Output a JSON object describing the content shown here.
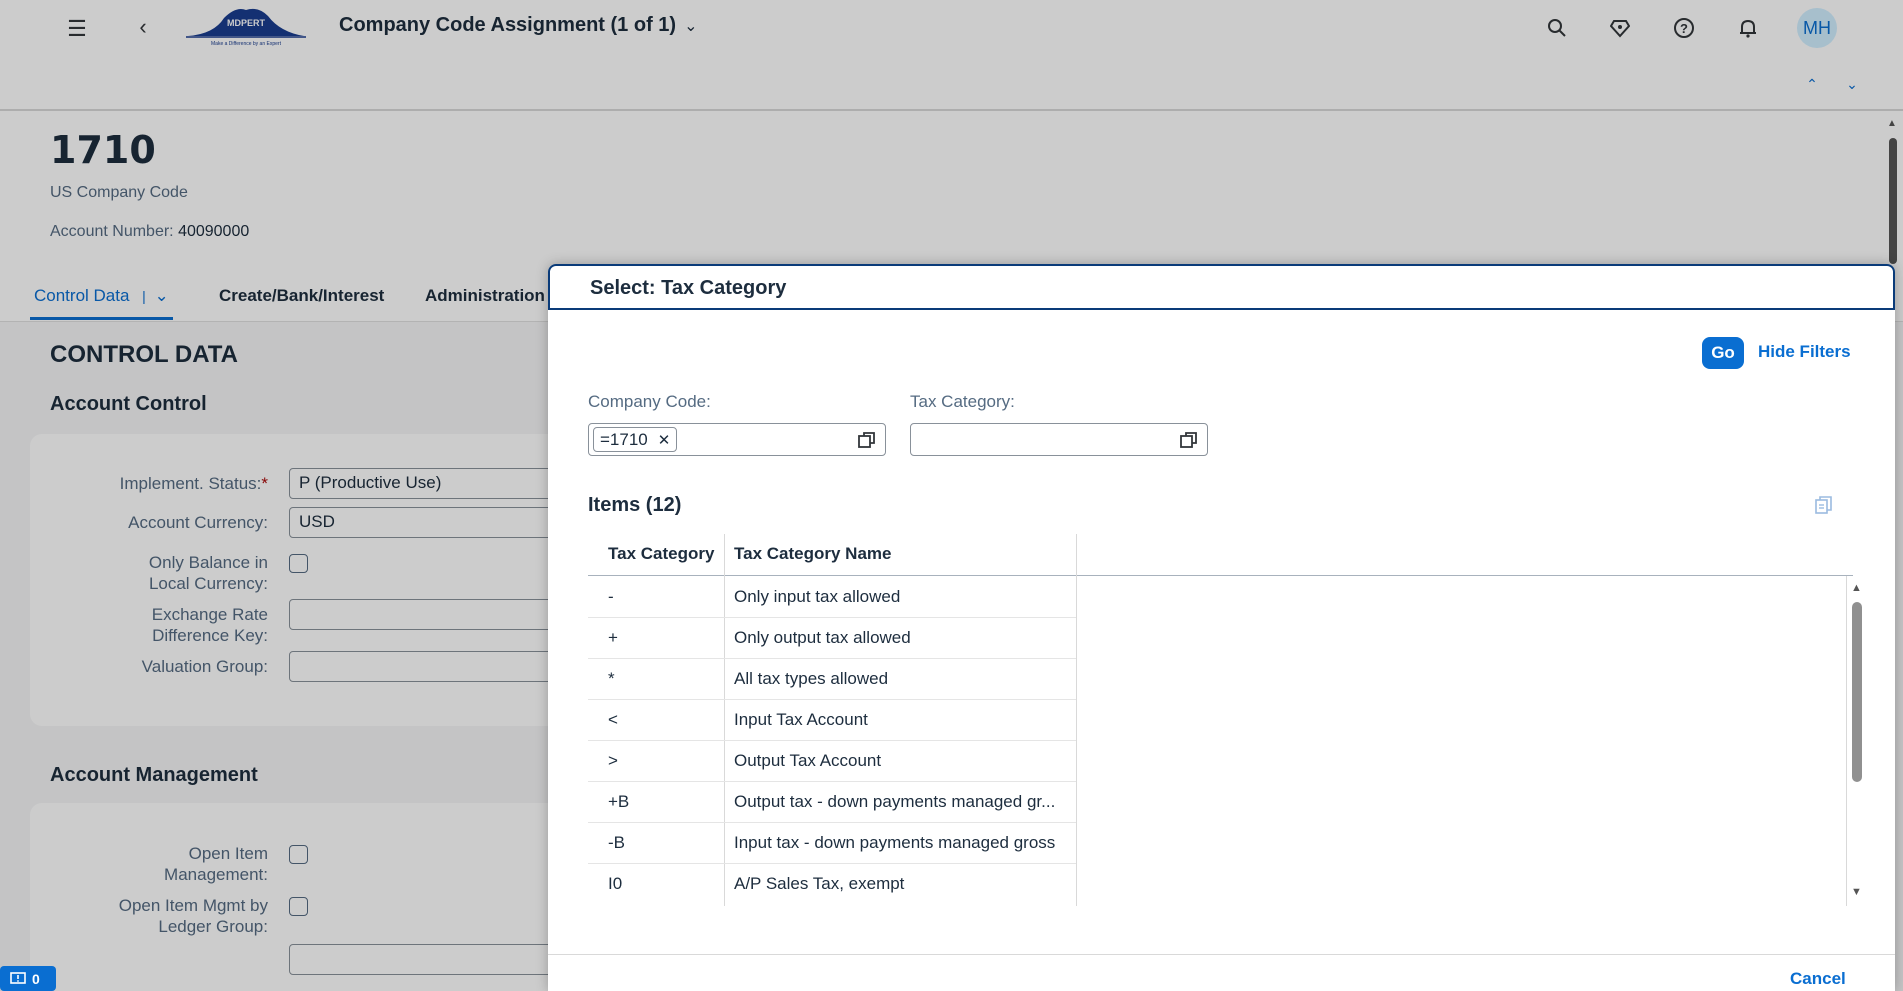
{
  "shell": {
    "app_title": "Company Code Assignment (1 of 1)",
    "logo_text": "MDPERT",
    "logo_tagline": "Make a Difference by an Expert",
    "avatar_initials": "MH",
    "icons": [
      "menu-icon",
      "back-icon",
      "search-icon",
      "diamond-icon",
      "help-icon",
      "bell-icon"
    ]
  },
  "object": {
    "title": "1710",
    "subtitle": "US Company Code",
    "account_label": "Account Number:",
    "account_value": "40090000"
  },
  "tabs": [
    {
      "label": "Control Data"
    },
    {
      "label": "Create/Bank/Interest"
    },
    {
      "label": "Administration"
    }
  ],
  "section": {
    "title": "CONTROL DATA",
    "account_control": {
      "title": "Account Control",
      "implement_status_label": "Implement. Status:",
      "implement_status_value": "P (Productive Use)",
      "account_currency_label": "Account Currency:",
      "account_currency_value": "USD",
      "only_balance_label_1": "Only Balance in",
      "only_balance_label_2": "Local Currency:",
      "exchange_rate_label_1": "Exchange Rate",
      "exchange_rate_label_2": "Difference Key:",
      "valuation_group_label": "Valuation Group:"
    },
    "account_management": {
      "title": "Account Management",
      "open_item_label_1": "Open Item",
      "open_item_label_2": "Management:",
      "open_item_ledger_label_1": "Open Item Mgmt by",
      "open_item_ledger_label_2": "Ledger Group:"
    }
  },
  "message_count": "0",
  "dialog": {
    "title": "Select: Tax Category",
    "go_label": "Go",
    "hide_filters_label": "Hide Filters",
    "company_code_label": "Company Code:",
    "company_code_token": "=1710",
    "tax_category_label": "Tax Category:",
    "items_title": "Items (12)",
    "columns": [
      "Tax Category",
      "Tax Category Name"
    ],
    "rows": [
      [
        "-",
        "Only input tax allowed"
      ],
      [
        "+",
        "Only output tax allowed"
      ],
      [
        "*",
        "All tax types allowed"
      ],
      [
        "<",
        "Input Tax Account"
      ],
      [
        ">",
        "Output Tax Account"
      ],
      [
        "+B",
        "Output tax - down payments managed gr..."
      ],
      [
        "-B",
        "Input tax - down payments managed gross"
      ],
      [
        "I0",
        "A/P Sales Tax, exempt"
      ]
    ],
    "cancel_label": "Cancel"
  },
  "colors": {
    "accent": "#0a6ed1",
    "header_border": "#0a3b79",
    "required": "#aa0808"
  }
}
